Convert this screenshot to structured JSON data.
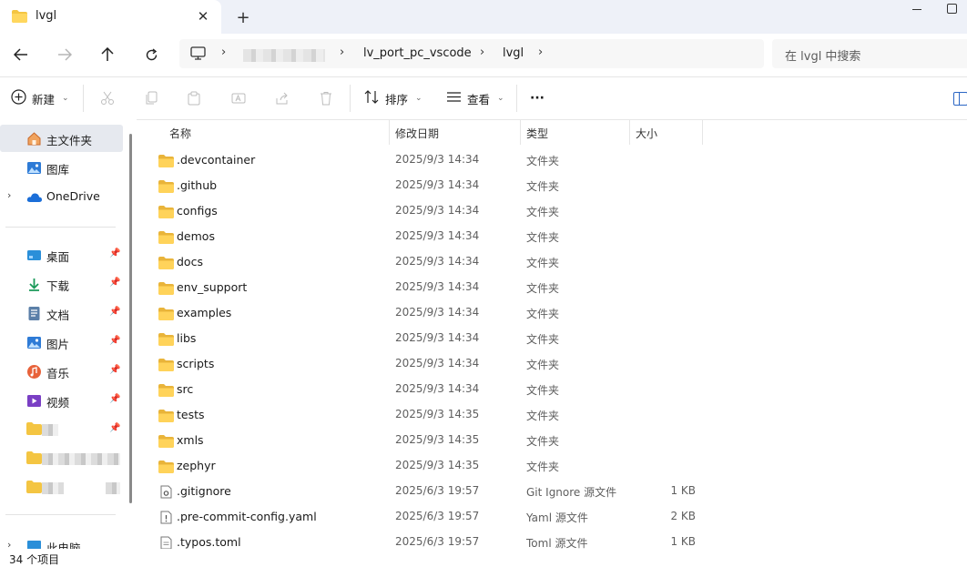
{
  "tab": {
    "title": "lvgl",
    "close_glyph": "✕",
    "new_glyph": "+"
  },
  "breadcrumb": {
    "items": [
      "lv_port_pc_vscode",
      "lvgl"
    ]
  },
  "search": {
    "placeholder": "在 lvgl 中搜索"
  },
  "toolbar": {
    "new_label": "新建",
    "sort_label": "排序",
    "view_label": "查看",
    "more_label": "···"
  },
  "sidebar": {
    "home": "主文件夹",
    "gallery": "图库",
    "onedrive": "OneDrive",
    "quick": [
      "桌面",
      "下载",
      "文档",
      "图片",
      "音乐",
      "视频"
    ],
    "thispc": "此电脑"
  },
  "columns": {
    "name": "名称",
    "date": "修改日期",
    "type": "类型",
    "size": "大小"
  },
  "files": [
    {
      "name": ".devcontainer",
      "date": "2025/9/3 14:34",
      "type": "文件夹",
      "size": "",
      "kind": "folder"
    },
    {
      "name": ".github",
      "date": "2025/9/3 14:34",
      "type": "文件夹",
      "size": "",
      "kind": "folder"
    },
    {
      "name": "configs",
      "date": "2025/9/3 14:34",
      "type": "文件夹",
      "size": "",
      "kind": "folder"
    },
    {
      "name": "demos",
      "date": "2025/9/3 14:34",
      "type": "文件夹",
      "size": "",
      "kind": "folder"
    },
    {
      "name": "docs",
      "date": "2025/9/3 14:34",
      "type": "文件夹",
      "size": "",
      "kind": "folder"
    },
    {
      "name": "env_support",
      "date": "2025/9/3 14:34",
      "type": "文件夹",
      "size": "",
      "kind": "folder"
    },
    {
      "name": "examples",
      "date": "2025/9/3 14:34",
      "type": "文件夹",
      "size": "",
      "kind": "folder"
    },
    {
      "name": "libs",
      "date": "2025/9/3 14:34",
      "type": "文件夹",
      "size": "",
      "kind": "folder"
    },
    {
      "name": "scripts",
      "date": "2025/9/3 14:34",
      "type": "文件夹",
      "size": "",
      "kind": "folder"
    },
    {
      "name": "src",
      "date": "2025/9/3 14:34",
      "type": "文件夹",
      "size": "",
      "kind": "folder"
    },
    {
      "name": "tests",
      "date": "2025/9/3 14:35",
      "type": "文件夹",
      "size": "",
      "kind": "folder"
    },
    {
      "name": "xmls",
      "date": "2025/9/3 14:35",
      "type": "文件夹",
      "size": "",
      "kind": "folder"
    },
    {
      "name": "zephyr",
      "date": "2025/9/3 14:35",
      "type": "文件夹",
      "size": "",
      "kind": "folder"
    },
    {
      "name": ".gitignore",
      "date": "2025/6/3 19:57",
      "type": "Git Ignore 源文件",
      "size": "1 KB",
      "kind": "gear"
    },
    {
      "name": ".pre-commit-config.yaml",
      "date": "2025/6/3 19:57",
      "type": "Yaml 源文件",
      "size": "2 KB",
      "kind": "excl"
    },
    {
      "name": ".typos.toml",
      "date": "2025/6/3 19:57",
      "type": "Toml 源文件",
      "size": "1 KB",
      "kind": "doc"
    }
  ],
  "status": {
    "item_count": "34 个项目"
  }
}
